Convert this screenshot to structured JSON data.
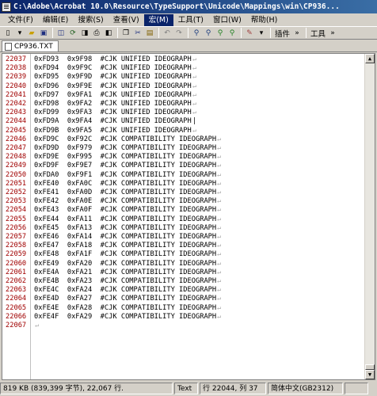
{
  "window": {
    "title": "C:\\Adobe\\Acrobat 10.0\\Resource\\TypeSupport\\Unicode\\Mappings\\win\\CP936..."
  },
  "menu": [
    {
      "label": "文件(F)"
    },
    {
      "label": "编辑(E)"
    },
    {
      "label": "搜索(S)"
    },
    {
      "label": "查看(V)"
    },
    {
      "label": "宏(M)"
    },
    {
      "label": "工具(T)"
    },
    {
      "label": "窗口(W)"
    },
    {
      "label": "帮助(H)"
    }
  ],
  "menu_active_index": 4,
  "toolbar": {
    "plugins_label": "插件",
    "tools_label": "工具"
  },
  "tab": {
    "label": "CP936.TXT"
  },
  "lines": [
    {
      "n": "22037",
      "t": "0xFD93  0x9F98  #CJK UNIFIED IDEOGRAPH"
    },
    {
      "n": "22038",
      "t": "0xFD94  0x9F9C  #CJK UNIFIED IDEOGRAPH"
    },
    {
      "n": "22039",
      "t": "0xFD95  0x9F9D  #CJK UNIFIED IDEOGRAPH"
    },
    {
      "n": "22040",
      "t": "0xFD96  0x9F9E  #CJK UNIFIED IDEOGRAPH"
    },
    {
      "n": "22041",
      "t": "0xFD97  0x9FA1  #CJK UNIFIED IDEOGRAPH"
    },
    {
      "n": "22042",
      "t": "0xFD98  0x9FA2  #CJK UNIFIED IDEOGRAPH"
    },
    {
      "n": "22043",
      "t": "0xFD99  0x9FA3  #CJK UNIFIED IDEOGRAPH"
    },
    {
      "n": "22044",
      "t": "0xFD9A  0x9FA4  #CJK UNIFIED IDEOGRAPH"
    },
    {
      "n": "22045",
      "t": "0xFD9B  0x9FA5  #CJK UNIFIED IDEOGRAPH"
    },
    {
      "n": "22046",
      "t": "0xFD9C  0xF92C  #CJK COMPATIBILITY IDEOGRAPH"
    },
    {
      "n": "22047",
      "t": "0xFD9D  0xF979  #CJK COMPATIBILITY IDEOGRAPH"
    },
    {
      "n": "22048",
      "t": "0xFD9E  0xF995  #CJK COMPATIBILITY IDEOGRAPH"
    },
    {
      "n": "22049",
      "t": "0xFD9F  0xF9E7  #CJK COMPATIBILITY IDEOGRAPH"
    },
    {
      "n": "22050",
      "t": "0xFDA0  0xF9F1  #CJK COMPATIBILITY IDEOGRAPH"
    },
    {
      "n": "22051",
      "t": "0xFE40  0xFA0C  #CJK COMPATIBILITY IDEOGRAPH"
    },
    {
      "n": "22052",
      "t": "0xFE41  0xFA0D  #CJK COMPATIBILITY IDEOGRAPH"
    },
    {
      "n": "22053",
      "t": "0xFE42  0xFA0E  #CJK COMPATIBILITY IDEOGRAPH"
    },
    {
      "n": "22054",
      "t": "0xFE43  0xFA0F  #CJK COMPATIBILITY IDEOGRAPH"
    },
    {
      "n": "22055",
      "t": "0xFE44  0xFA11  #CJK COMPATIBILITY IDEOGRAPH"
    },
    {
      "n": "22056",
      "t": "0xFE45  0xFA13  #CJK COMPATIBILITY IDEOGRAPH"
    },
    {
      "n": "22057",
      "t": "0xFE46  0xFA14  #CJK COMPATIBILITY IDEOGRAPH"
    },
    {
      "n": "22058",
      "t": "0xFE47  0xFA18  #CJK COMPATIBILITY IDEOGRAPH"
    },
    {
      "n": "22059",
      "t": "0xFE48  0xFA1F  #CJK COMPATIBILITY IDEOGRAPH"
    },
    {
      "n": "22060",
      "t": "0xFE49  0xFA20  #CJK COMPATIBILITY IDEOGRAPH"
    },
    {
      "n": "22061",
      "t": "0xFE4A  0xFA21  #CJK COMPATIBILITY IDEOGRAPH"
    },
    {
      "n": "22062",
      "t": "0xFE4B  0xFA23  #CJK COMPATIBILITY IDEOGRAPH"
    },
    {
      "n": "22063",
      "t": "0xFE4C  0xFA24  #CJK COMPATIBILITY IDEOGRAPH"
    },
    {
      "n": "22064",
      "t": "0xFE4D  0xFA27  #CJK COMPATIBILITY IDEOGRAPH"
    },
    {
      "n": "22065",
      "t": "0xFE4E  0xFA28  #CJK COMPATIBILITY IDEOGRAPH"
    },
    {
      "n": "22066",
      "t": "0xFE4F  0xFA29  #CJK COMPATIBILITY IDEOGRAPH"
    },
    {
      "n": "22067",
      "t": ""
    }
  ],
  "status": {
    "size": "819 KB (839,399 字节), 22,067 行.",
    "mode": "Text",
    "position": "行 22044, 列 37",
    "encoding": "简体中文(GB2312)"
  },
  "colors": {
    "line_number": "#a00000",
    "menu_highlight": "#0a246a"
  }
}
